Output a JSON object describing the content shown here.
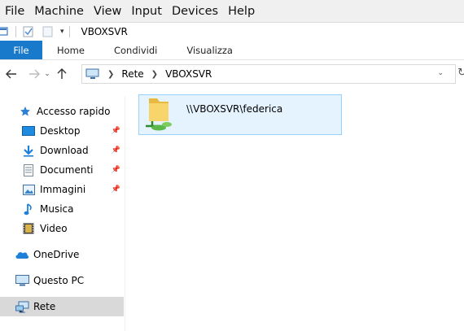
{
  "host_menu": [
    "File",
    "Machine",
    "View",
    "Input",
    "Devices",
    "Help"
  ],
  "window": {
    "title": "VBOXSVR"
  },
  "ribbon": {
    "tabs": [
      "File",
      "Home",
      "Condividi",
      "Visualizza"
    ]
  },
  "address": {
    "segments": [
      "Rete",
      "VBOXSVR"
    ]
  },
  "nav": {
    "quick_access": "Accesso rapido",
    "items": [
      {
        "label": "Desktop",
        "icon": "desktop-icon",
        "pinned": true
      },
      {
        "label": "Download",
        "icon": "download-icon",
        "pinned": true
      },
      {
        "label": "Documenti",
        "icon": "documents-icon",
        "pinned": true
      },
      {
        "label": "Immagini",
        "icon": "pictures-icon",
        "pinned": true
      },
      {
        "label": "Musica",
        "icon": "music-icon",
        "pinned": false
      },
      {
        "label": "Video",
        "icon": "video-icon",
        "pinned": false
      }
    ],
    "onedrive": "OneDrive",
    "this_pc": "Questo PC",
    "network": "Rete"
  },
  "content": {
    "items": [
      {
        "name": "\\\\VBOXSVR\\federica",
        "icon": "network-share-folder-icon"
      }
    ]
  },
  "colors": {
    "accent": "#1979ca",
    "selection": "#e5f3ff",
    "selection_border": "#99d1ff",
    "nav_selected": "#d9d9d9"
  }
}
